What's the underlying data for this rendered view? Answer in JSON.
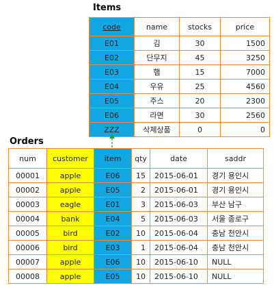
{
  "items": {
    "title": "Items",
    "columns": [
      "code",
      "name",
      "stocks",
      "price"
    ],
    "rows": [
      [
        "E01",
        "김",
        "30",
        "1500"
      ],
      [
        "E02",
        "단무지",
        "45",
        "3250"
      ],
      [
        "E03",
        "햄",
        "15",
        "7000"
      ],
      [
        "E04",
        "우유",
        "25",
        "4560"
      ],
      [
        "E05",
        "주스",
        "20",
        "2300"
      ],
      [
        "E06",
        "라면",
        "30",
        "2560"
      ],
      [
        "ZZZ",
        "삭제상품",
        "0",
        "0"
      ]
    ]
  },
  "orders": {
    "title": "Orders",
    "columns": [
      "num",
      "customer",
      "item",
      "qty",
      "date",
      "saddr"
    ],
    "rows": [
      [
        "00001",
        "apple",
        "E06",
        "15",
        "2015-06-01",
        "경기 용인시"
      ],
      [
        "00002",
        "apple",
        "E05",
        "2",
        "2015-06-01",
        "경기 용인시"
      ],
      [
        "00003",
        "eagle",
        "E01",
        "3",
        "2015-06-03",
        "부산 남구"
      ],
      [
        "00004",
        "bank",
        "E04",
        "5",
        "2015-06-03",
        "서울 종로구"
      ],
      [
        "00005",
        "bird",
        "E02",
        "10",
        "2015-06-04",
        "충남 천안시"
      ],
      [
        "00006",
        "bird",
        "E03",
        "1",
        "2015-06-04",
        "충남 천안시"
      ],
      [
        "00007",
        "apple",
        "E06",
        "10",
        "2015-06-10",
        "NULL"
      ],
      [
        "00008",
        "apple",
        "E05",
        "10",
        "2015-06-10",
        "NULL"
      ]
    ]
  },
  "colors": {
    "border": "#f28a3c",
    "key_blue": "#12a7e2",
    "highlight_yellow": "#ffff00",
    "arrow_green": "#2e9e3e"
  }
}
